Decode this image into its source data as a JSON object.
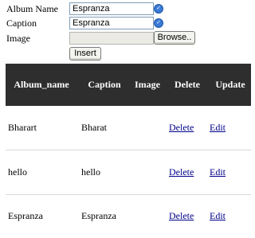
{
  "form": {
    "album_name_label": "Album Name",
    "album_name_value": "Espranza",
    "caption_label": "Caption",
    "caption_value": "Espranza",
    "image_label": "Image",
    "image_value": "",
    "browse_label": "Browse..",
    "insert_label": "Insert"
  },
  "table": {
    "headers": [
      "Album_name",
      "Caption",
      "Image",
      "Delete",
      "Update"
    ],
    "rows": [
      {
        "album_name": "Bharart",
        "caption": "Bharat",
        "delete": "Delete",
        "edit": "Edit"
      },
      {
        "album_name": "hello",
        "caption": "hello",
        "delete": "Delete",
        "edit": "Edit"
      },
      {
        "album_name": "Espranza",
        "caption": "Espranza",
        "delete": "Delete",
        "edit": "Edit"
      }
    ],
    "header_bg": "#2e2e2e",
    "link_color": "#00008b"
  },
  "icons": {
    "spell_icon": "spellcheck-icon"
  }
}
